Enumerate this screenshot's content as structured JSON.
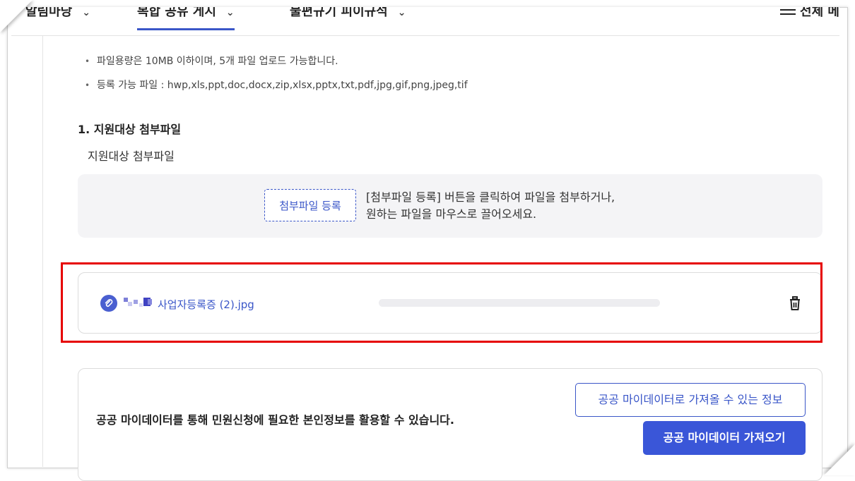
{
  "nav": {
    "tabs": [
      {
        "label": "알림마당"
      },
      {
        "label": "복합 공유 게시"
      },
      {
        "label": "불편규기 피이규석"
      }
    ],
    "all_menu_label": "전체 메"
  },
  "notes": [
    "파일용량은 10MB 이하이며, 5개 파일 업로드 가능합니다.",
    "등록 가능 파일 : hwp,xls,ppt,doc,docx,zip,xlsx,pptx,txt,pdf,jpg,gif,png,jpeg,tif"
  ],
  "section": {
    "title": "1. 지원대상 첨부파일",
    "subtitle": "지원대상 첨부파일"
  },
  "dropzone": {
    "button_label": "첨부파일 등록",
    "desc_line1": "[첨부파일 등록] 버튼을 클릭하여 파일을 첨부하거나,",
    "desc_line2": "원하는 파일을 마우스로 끌어오세요."
  },
  "file": {
    "name": "사업자등록증 (2).jpg",
    "progress": 1.0
  },
  "mydata": {
    "description": "공공 마이데이터를 통해 민원신청에 필요한 본인정보를 활용할 수 있습니다.",
    "info_button": "공공 마이데이터로 가져올 수 있는 정보",
    "fetch_button": "공공 마이데이터 가져오기"
  },
  "colors": {
    "accent": "#3a56c8",
    "highlight": "#e60000"
  }
}
